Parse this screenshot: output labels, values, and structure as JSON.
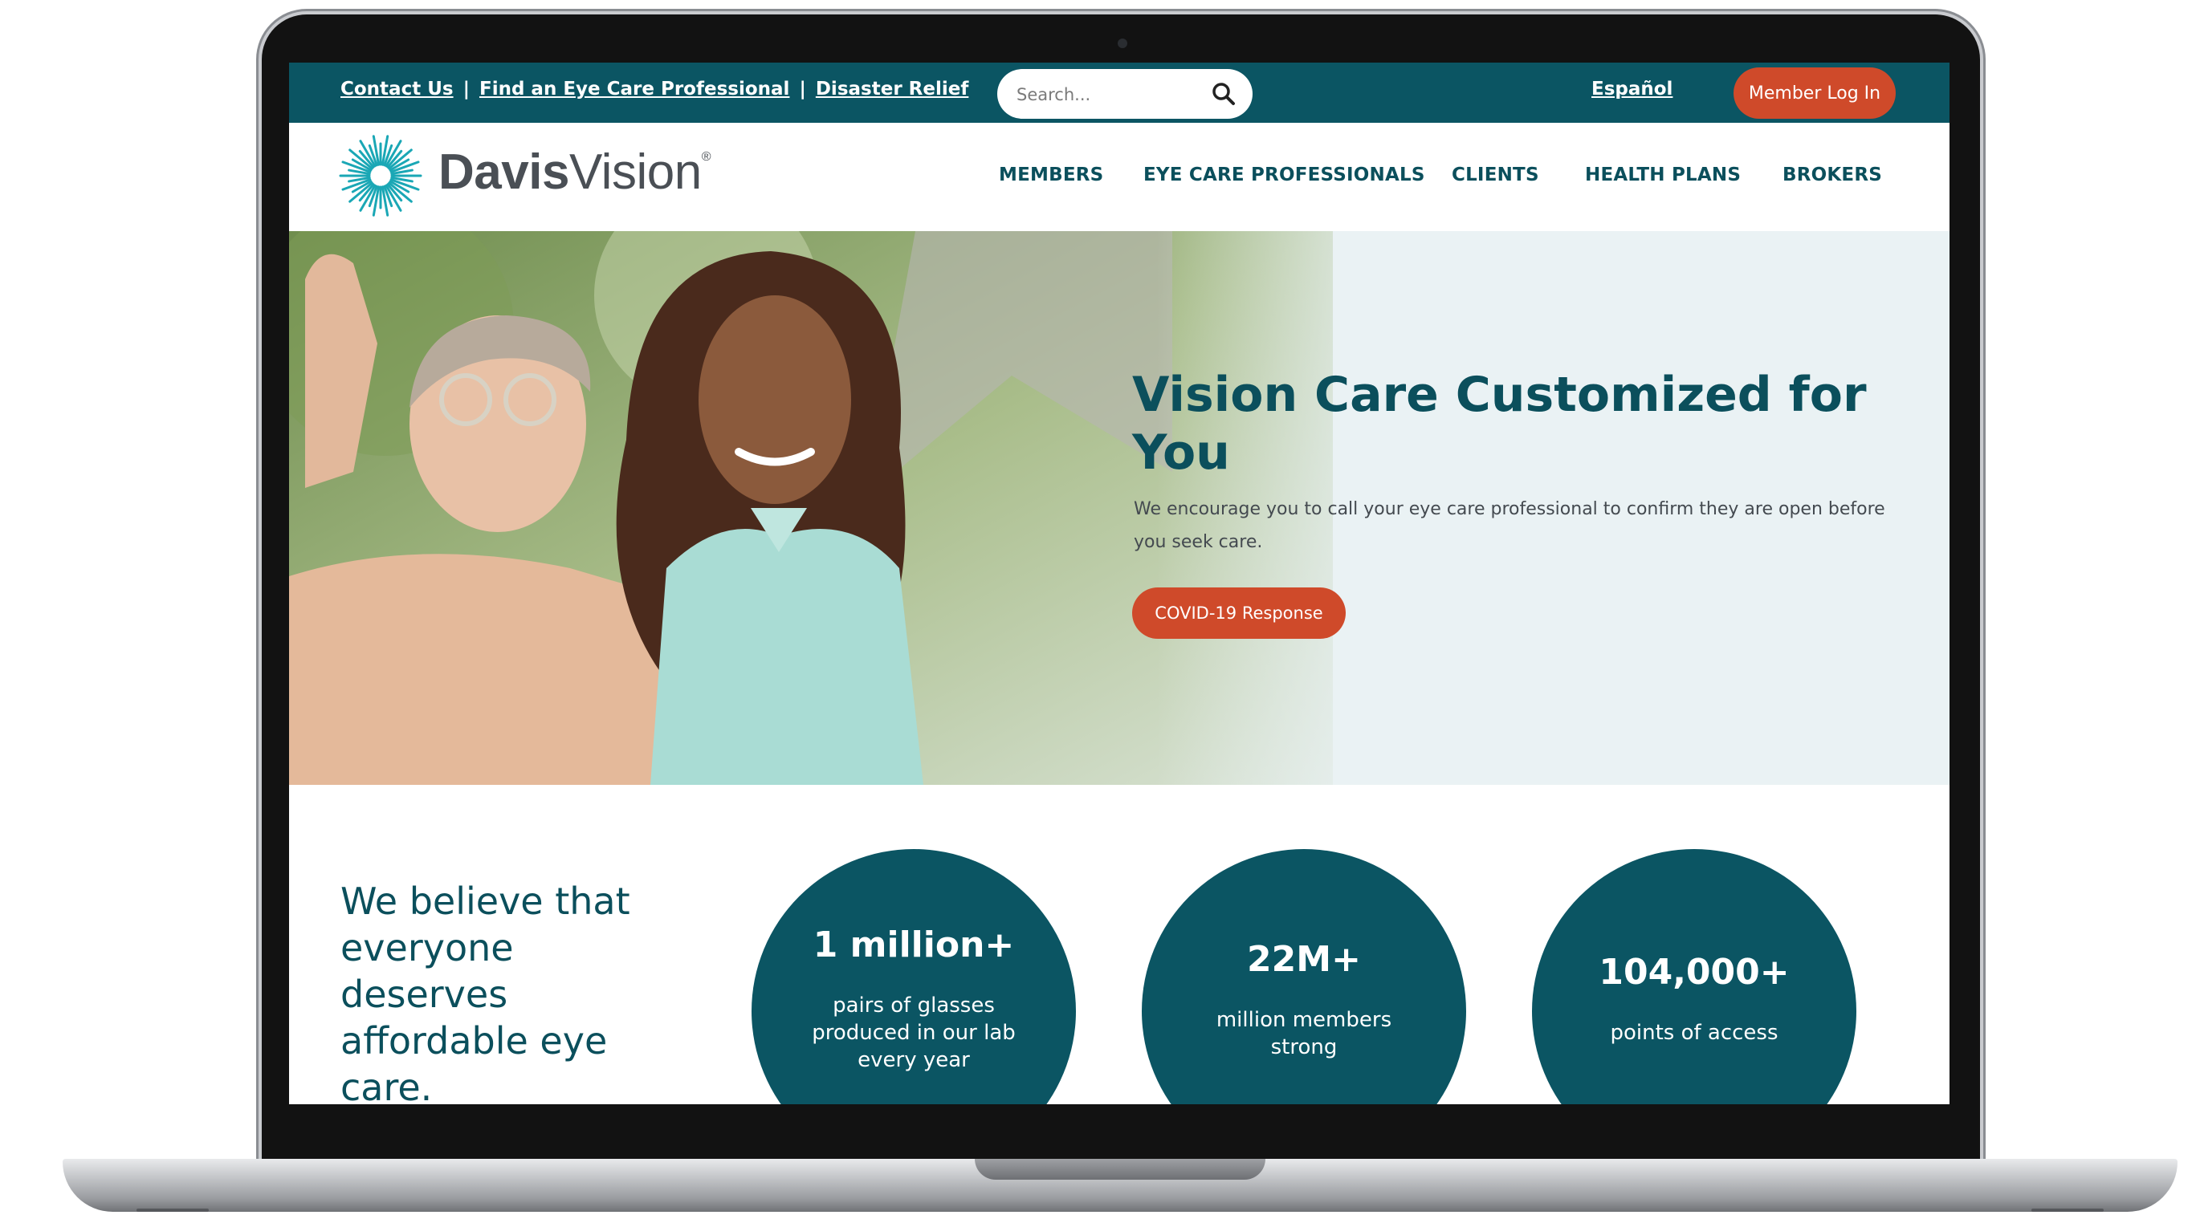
{
  "utility_bar": {
    "links": [
      "Contact Us",
      "Find an Eye Care Professional",
      "Disaster Relief"
    ],
    "separator": "|",
    "search_placeholder": "Search...",
    "espanol": "Español",
    "login": "Member Log In"
  },
  "header": {
    "logo_bold": "Davis",
    "logo_light": "Vision",
    "logo_mark": "®",
    "nav": [
      "MEMBERS",
      "EYE CARE PROFESSIONALS",
      "CLIENTS",
      "HEALTH PLANS",
      "BROKERS"
    ]
  },
  "hero": {
    "title": "Vision Care Customized for You",
    "subtitle": "We encourage you to call your eye care professional to confirm they are open before you seek care.",
    "button": "COVID-19 Response"
  },
  "stats_section": {
    "belief": "We believe that everyone deserves affordable eye care.",
    "stats": [
      {
        "number": "1 million+",
        "label": "pairs of glasses produced in our lab every year"
      },
      {
        "number": "22M+",
        "label": "million members strong"
      },
      {
        "number": "104,000+",
        "label": "points of access"
      }
    ]
  },
  "colors": {
    "teal": "#0b5563",
    "accent": "#cf4a2a",
    "hero_bg": "#eaf2f4",
    "logo_teal": "#1aa7b5"
  },
  "icons": [
    "search-icon",
    "sunburst-logo-icon"
  ]
}
